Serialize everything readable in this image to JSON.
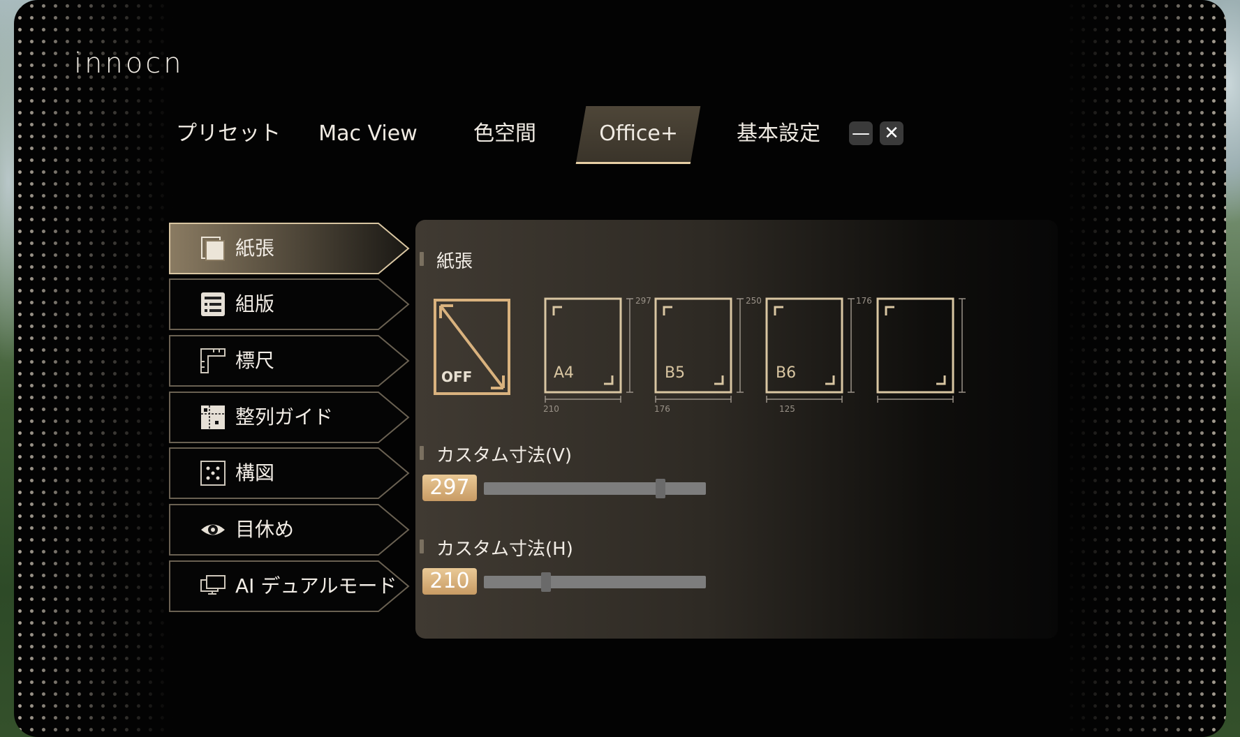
{
  "app": {
    "logo": "innocn"
  },
  "tabs": [
    {
      "label": "プリセット",
      "active": false
    },
    {
      "label": "Mac View",
      "active": false
    },
    {
      "label": "色空間",
      "active": false
    },
    {
      "label": "Office+",
      "active": true
    },
    {
      "label": "基本設定",
      "active": false
    }
  ],
  "window": {
    "minimize_icon": "minimize-icon",
    "close_icon": "close-icon",
    "minimize_glyph": "—",
    "close_glyph": "✕"
  },
  "sidebar": {
    "items": [
      {
        "label": "紙張",
        "icon": "paper-stack-icon",
        "active": true
      },
      {
        "label": "組版",
        "icon": "layout-grid-icon",
        "active": false
      },
      {
        "label": "標尺",
        "icon": "ruler-icon",
        "active": false
      },
      {
        "label": "整列ガイド",
        "icon": "align-guide-icon",
        "active": false
      },
      {
        "label": "構図",
        "icon": "composition-icon",
        "active": false
      },
      {
        "label": "目休め",
        "icon": "eye-icon",
        "active": false
      },
      {
        "label": "AI デュアルモード",
        "icon": "dual-monitor-icon",
        "active": false
      }
    ]
  },
  "content": {
    "section_title": "紙張",
    "papers": [
      {
        "label": "OFF",
        "icon": "off-diagonal-icon",
        "selected": true
      },
      {
        "label": "A4",
        "height_label": "297",
        "width_label": "210"
      },
      {
        "label": "B5",
        "height_label": "250",
        "width_label": "176"
      },
      {
        "label": "B6",
        "height_label": "176",
        "width_label": "125"
      },
      {
        "label": ""
      }
    ],
    "custom_v": {
      "label": "カスタム寸法(V)",
      "value": "297",
      "fraction": 0.81
    },
    "custom_h": {
      "label": "カスタム寸法(H)",
      "value": "210",
      "fraction": 0.27
    }
  },
  "colors": {
    "accent": "#e7cfa5",
    "badge": "#d9b27e",
    "background": "#030303"
  }
}
